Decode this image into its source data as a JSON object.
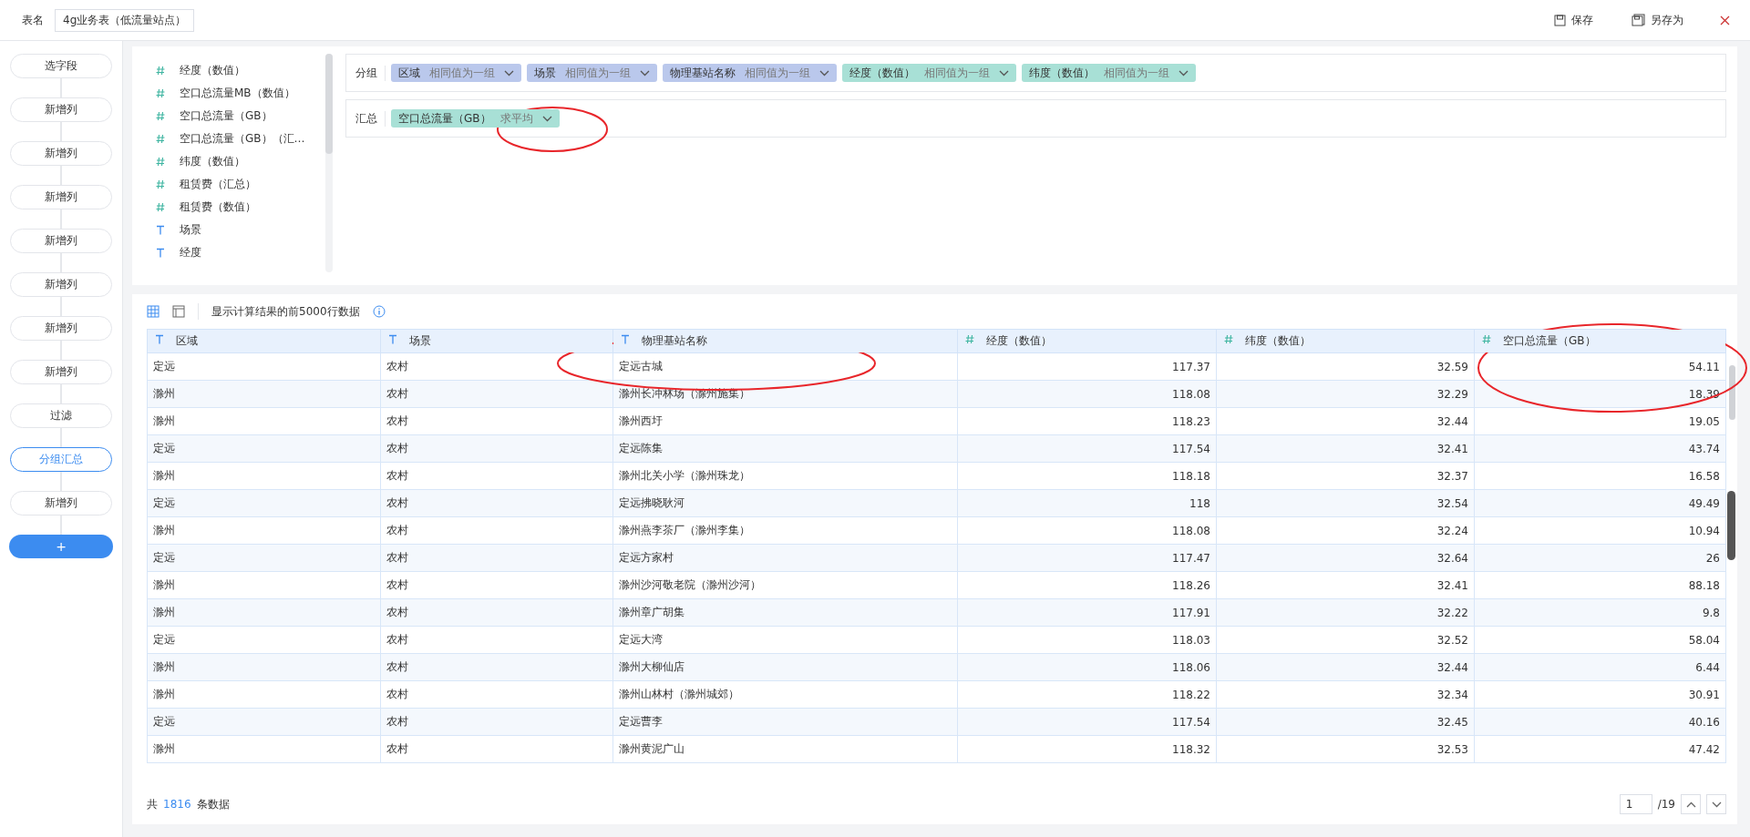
{
  "header": {
    "title_label": "表名",
    "title_value": "4g业务表（低流量站点）",
    "actions": [
      {
        "kind": "save",
        "label": "保存"
      },
      {
        "kind": "save_as",
        "label": "另存为"
      }
    ]
  },
  "steps": [
    {
      "label": "选字段",
      "selected": false
    },
    {
      "label": "新增列",
      "selected": false
    },
    {
      "label": "新增列",
      "selected": false
    },
    {
      "label": "新增列",
      "selected": false
    },
    {
      "label": "新增列",
      "selected": false
    },
    {
      "label": "新增列",
      "selected": false
    },
    {
      "label": "新增列",
      "selected": false
    },
    {
      "label": "新增列",
      "selected": false
    },
    {
      "label": "过滤",
      "selected": false
    },
    {
      "label": "分组汇总",
      "selected": true
    },
    {
      "label": "新增列",
      "selected": false
    }
  ],
  "add_step": "+",
  "fields": [
    {
      "kind": "number",
      "label": "经度（数值）"
    },
    {
      "kind": "number",
      "label": "空口总流量MB（数值）"
    },
    {
      "kind": "number",
      "label": "空口总流量（GB）"
    },
    {
      "kind": "number",
      "label": "空口总流量（GB）（汇…"
    },
    {
      "kind": "number",
      "label": "纬度（数值）"
    },
    {
      "kind": "number",
      "label": "租赁费（汇总）"
    },
    {
      "kind": "number",
      "label": "租赁费（数值）"
    },
    {
      "kind": "text",
      "label": "场景"
    },
    {
      "kind": "text",
      "label": "经度"
    }
  ],
  "group": {
    "label": "分组",
    "items": [
      {
        "kind": "text",
        "name": "区域",
        "mode": "相同值为一组"
      },
      {
        "kind": "text",
        "name": "场景",
        "mode": "相同值为一组"
      },
      {
        "kind": "text",
        "name": "物理基站名称",
        "mode": "相同值为一组"
      },
      {
        "kind": "number",
        "name": "经度（数值）",
        "mode": "相同值为一组"
      },
      {
        "kind": "number",
        "name": "纬度（数值）",
        "mode": "相同值为一组"
      }
    ]
  },
  "summary": {
    "label": "汇总",
    "items": [
      {
        "kind": "number",
        "name": "空口总流量（GB）",
        "mode": "求平均"
      }
    ]
  },
  "table": {
    "note": "显示计算结果的前5000行数据",
    "columns": [
      {
        "kind": "text",
        "label": "区域"
      },
      {
        "kind": "text",
        "label": "场景"
      },
      {
        "kind": "text",
        "label": "物理基站名称"
      },
      {
        "kind": "number",
        "label": "经度（数值）"
      },
      {
        "kind": "number",
        "label": "纬度（数值）"
      },
      {
        "kind": "number",
        "label": "空口总流量（GB）"
      }
    ],
    "rows": [
      [
        "定远",
        "农村",
        "定远古城",
        "117.37",
        "32.59",
        "54.11"
      ],
      [
        "滁州",
        "农村",
        "滁州长冲林场（滁州施集）",
        "118.08",
        "32.29",
        "18.39"
      ],
      [
        "滁州",
        "农村",
        "滁州西圩",
        "118.23",
        "32.44",
        "19.05"
      ],
      [
        "定远",
        "农村",
        "定远陈集",
        "117.54",
        "32.41",
        "43.74"
      ],
      [
        "滁州",
        "农村",
        "滁州北关小学（滁州珠龙）",
        "118.18",
        "32.37",
        "16.58"
      ],
      [
        "定远",
        "农村",
        "定远拂晓耿河",
        "118",
        "32.54",
        "49.49"
      ],
      [
        "滁州",
        "农村",
        "滁州燕李茶厂（滁州李集）",
        "118.08",
        "32.24",
        "10.94"
      ],
      [
        "定远",
        "农村",
        "定远方家村",
        "117.47",
        "32.64",
        "26"
      ],
      [
        "滁州",
        "农村",
        "滁州沙河敬老院（滁州沙河）",
        "118.26",
        "32.41",
        "88.18"
      ],
      [
        "滁州",
        "农村",
        "滁州章广胡集",
        "117.91",
        "32.22",
        "9.8"
      ],
      [
        "定远",
        "农村",
        "定远大湾",
        "118.03",
        "32.52",
        "58.04"
      ],
      [
        "滁州",
        "农村",
        "滁州大柳仙店",
        "118.06",
        "32.44",
        "6.44"
      ],
      [
        "滁州",
        "农村",
        "滁州山林村（滁州城郊）",
        "118.22",
        "32.34",
        "30.91"
      ],
      [
        "定远",
        "农村",
        "定远曹李",
        "117.54",
        "32.45",
        "40.16"
      ],
      [
        "滁州",
        "农村",
        "滁州黄泥广山",
        "118.32",
        "32.53",
        "47.42"
      ]
    ]
  },
  "footer": {
    "prefix": "共",
    "count": "1816",
    "suffix": "条数据",
    "page": "1",
    "pages": "/19"
  }
}
